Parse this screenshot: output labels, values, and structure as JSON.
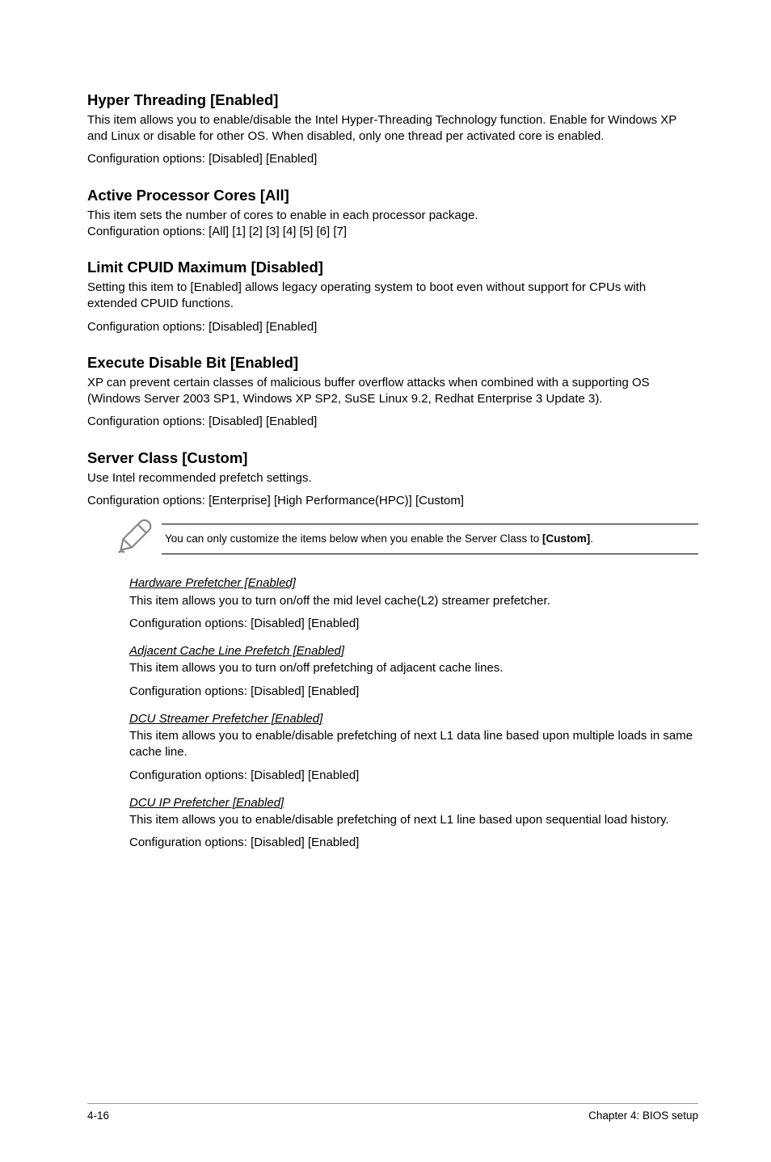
{
  "sections": [
    {
      "title": "Hyper Threading [Enabled]",
      "paras": [
        "This item allows you to enable/disable the Intel Hyper-Threading Technology function. Enable for Windows XP and Linux or disable for other OS. When disabled, only one thread per activated core is enabled.",
        "Configuration options: [Disabled] [Enabled]"
      ]
    },
    {
      "title": "Active Processor Cores [All]",
      "paras": [
        "This item sets the number of cores to enable in each processor package.",
        "Configuration options: [All] [1] [2] [3] [4] [5] [6] [7]"
      ]
    },
    {
      "title": "Limit CPUID Maximum [Disabled]",
      "paras": [
        "Setting this item to [Enabled] allows legacy operating system to boot even without support for CPUs with extended CPUID functions.",
        "Configuration options: [Disabled] [Enabled]"
      ]
    },
    {
      "title": "Execute Disable Bit [Enabled]",
      "paras": [
        "XP can prevent certain classes of malicious buffer overflow attacks when combined with a supporting OS (Windows Server 2003 SP1, Windows XP SP2, SuSE Linux 9.2, Redhat Enterprise 3 Update 3).",
        "Configuration options: [Disabled] [Enabled]"
      ]
    },
    {
      "title": "Server Class [Custom]",
      "paras": [
        "Use Intel recommended prefetch settings.",
        "Configuration options: [Enterprise] [High Performance(HPC)] [Custom]"
      ]
    }
  ],
  "note": {
    "prefix": "You can only customize the items below when you enable the Server Class to ",
    "bold": "[Custom]",
    "suffix": "."
  },
  "subs": [
    {
      "title": "Hardware Prefetcher [Enabled]",
      "paras": [
        "This item allows you to turn on/off the mid level cache(L2) streamer prefetcher.",
        "Configuration options: [Disabled] [Enabled]"
      ]
    },
    {
      "title": "Adjacent Cache Line Prefetch [Enabled]",
      "paras": [
        "This item allows you to turn on/off prefetching of adjacent cache lines.",
        "Configuration options: [Disabled] [Enabled]"
      ]
    },
    {
      "title": "DCU Streamer Prefetcher [Enabled]",
      "paras": [
        "This item allows you to enable/disable prefetching of next L1 data line based upon multiple loads in same cache line.",
        "Configuration options: [Disabled] [Enabled]"
      ]
    },
    {
      "title": "DCU IP Prefetcher [Enabled]",
      "paras": [
        "This item allows you to enable/disable prefetching of next L1 line based upon sequential load history.",
        "Configuration options: [Disabled] [Enabled]"
      ]
    }
  ],
  "footer": {
    "left": "4-16",
    "right": "Chapter 4: BIOS setup"
  }
}
